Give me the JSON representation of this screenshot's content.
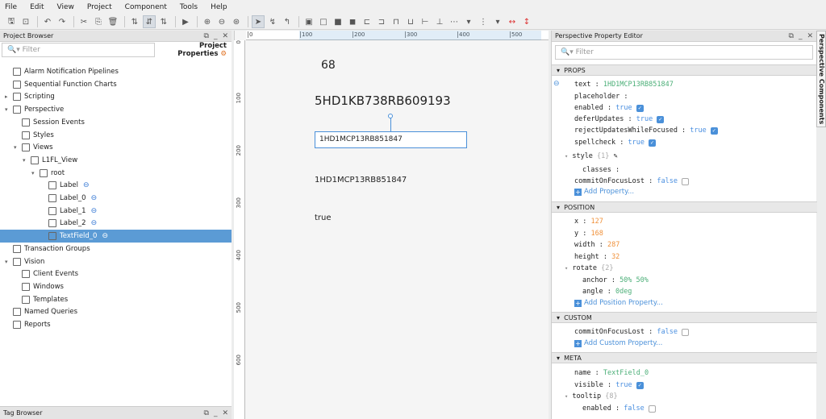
{
  "menu": [
    "File",
    "Edit",
    "View",
    "Project",
    "Component",
    "Tools",
    "Help"
  ],
  "project_browser": {
    "title": "Project Browser",
    "filter_placeholder": "Filter",
    "project_properties": "Project Properties",
    "items": [
      {
        "label": "Alarm Notification Pipelines",
        "depth": 0
      },
      {
        "label": "Sequential Function Charts",
        "depth": 0
      },
      {
        "label": "Scripting",
        "depth": 0,
        "arrow": "▸"
      },
      {
        "label": "Perspective",
        "depth": 0,
        "arrow": "▾"
      },
      {
        "label": "Session Events",
        "depth": 1
      },
      {
        "label": "Styles",
        "depth": 1
      },
      {
        "label": "Views",
        "depth": 1,
        "arrow": "▾"
      },
      {
        "label": "L1FL_View",
        "depth": 2,
        "arrow": "▾"
      },
      {
        "label": "root",
        "depth": 3,
        "arrow": "▾"
      },
      {
        "label": "Label",
        "depth": 4,
        "link": true
      },
      {
        "label": "Label_0",
        "depth": 4,
        "link": true
      },
      {
        "label": "Label_1",
        "depth": 4,
        "link": true
      },
      {
        "label": "Label_2",
        "depth": 4,
        "link": true
      },
      {
        "label": "TextField_0",
        "depth": 4,
        "link": true,
        "selected": true
      },
      {
        "label": "Transaction Groups",
        "depth": 0
      },
      {
        "label": "Vision",
        "depth": 0,
        "arrow": "▾"
      },
      {
        "label": "Client Events",
        "depth": 1
      },
      {
        "label": "Windows",
        "depth": 1
      },
      {
        "label": "Templates",
        "depth": 1
      },
      {
        "label": "Named Queries",
        "depth": 0
      },
      {
        "label": "Reports",
        "depth": 0
      }
    ]
  },
  "tag_browser": {
    "title": "Tag Browser"
  },
  "rulers": {
    "top": [
      "0",
      "100",
      "200",
      "300",
      "400",
      "500"
    ],
    "left": [
      "0",
      "100",
      "200",
      "300",
      "400",
      "500",
      "600"
    ]
  },
  "canvas": {
    "label": "68",
    "label_0": "5HD1KB738RB609193",
    "textfield": "1HD1MCP13RB851847",
    "label_1": "1HD1MCP13RB851847",
    "label_2": "true"
  },
  "property_editor": {
    "title": "Perspective Property Editor",
    "filter_placeholder": "Filter",
    "side_tab": "Perspective Components",
    "sections": {
      "props": "PROPS",
      "position": "POSITION",
      "custom": "CUSTOM",
      "meta": "META"
    },
    "props": {
      "text": "1HD1MCP13RB851847",
      "placeholder": "",
      "enabled": "true",
      "deferUpdates": "true",
      "rejectUpdatesWhileFocused": "true",
      "spellcheck": "true",
      "style_count": "{1}",
      "classes": "",
      "commitOnFocusLost": "false",
      "add": "Add Property..."
    },
    "position": {
      "x": "127",
      "y": "168",
      "width": "287",
      "height": "32",
      "rotate_count": "{2}",
      "anchor": "50% 50%",
      "angle": "0deg",
      "add": "Add Position Property..."
    },
    "custom": {
      "commitOnFocusLost": "false",
      "add": "Add Custom Property..."
    },
    "meta": {
      "name": "TextField_0",
      "visible": "true",
      "tooltip_count": "{8}",
      "enabled": "false"
    }
  },
  "colors": {
    "accent": "#5b9bd5",
    "string": "#4caf78",
    "number": "#f0913a",
    "boolean": "#4a8fe0"
  }
}
